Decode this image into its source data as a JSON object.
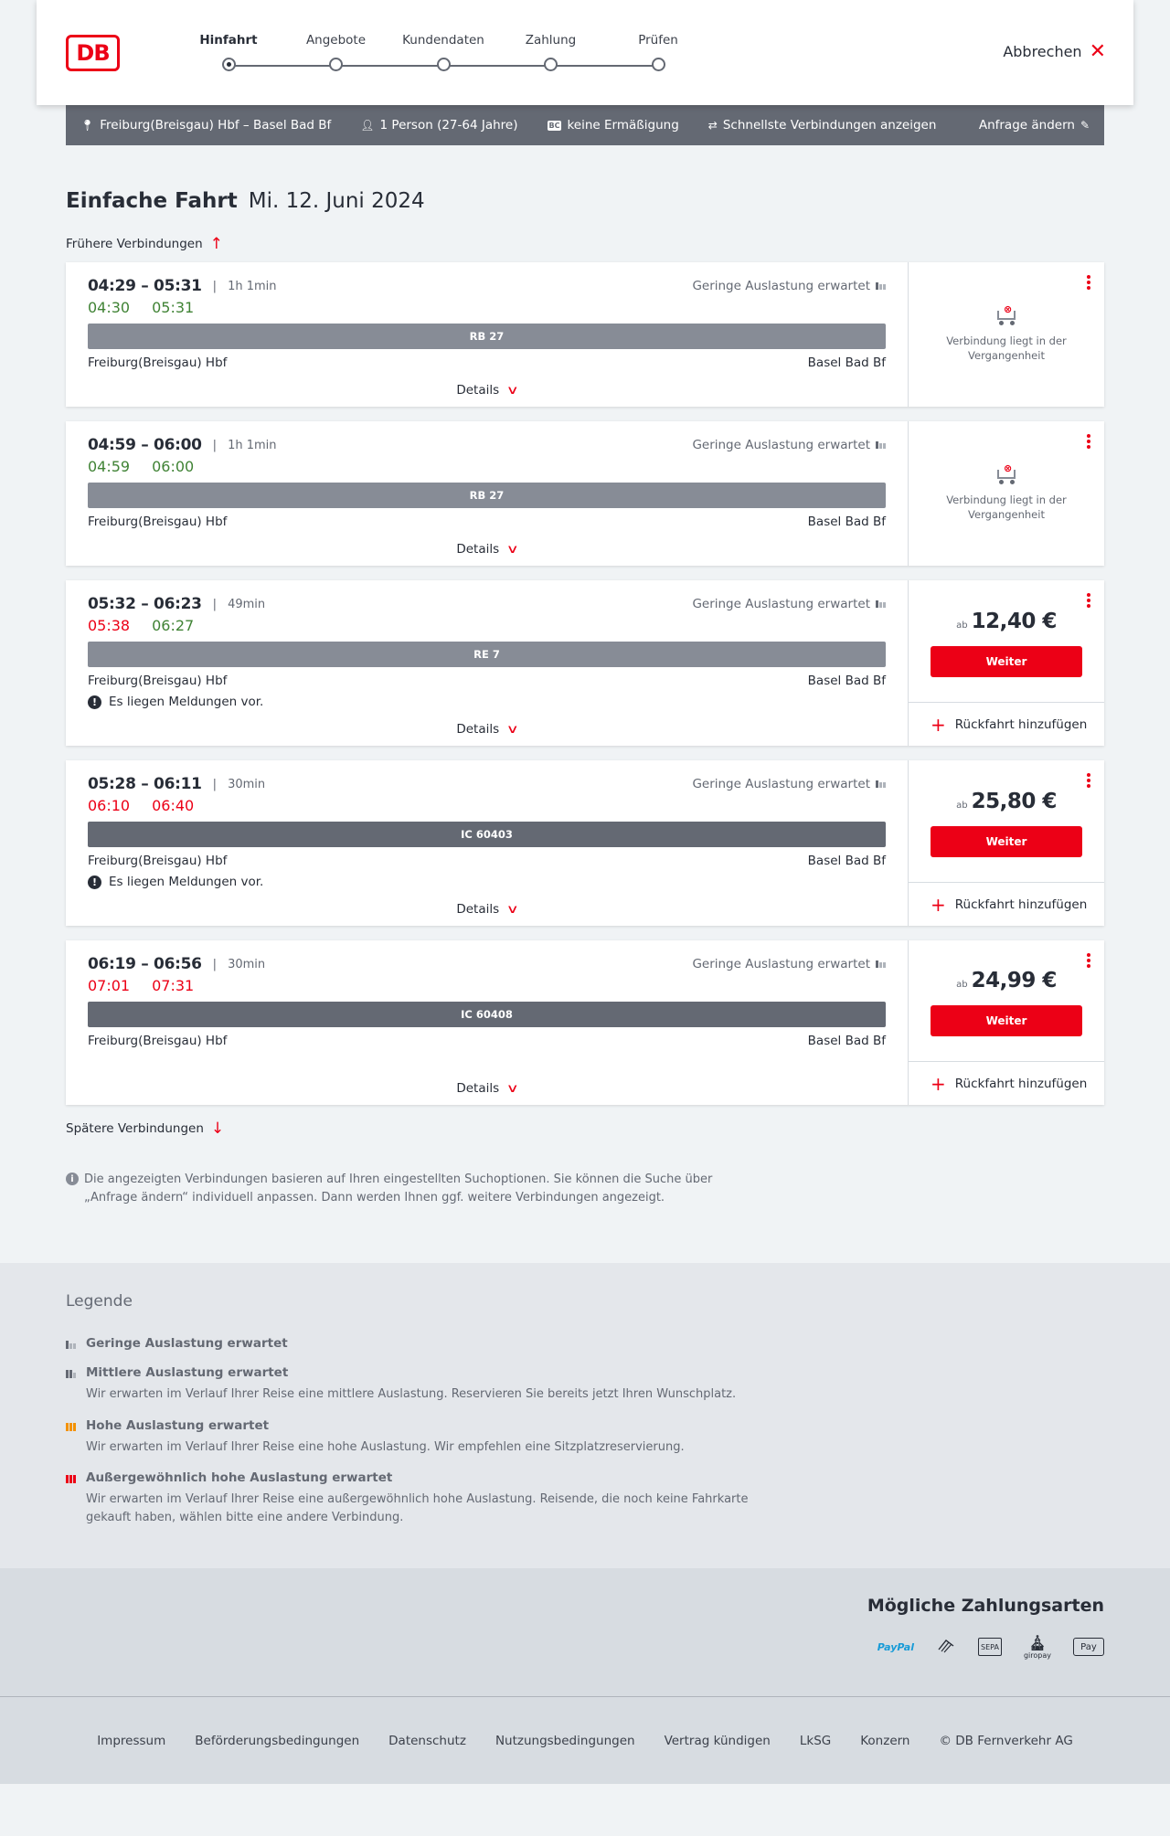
{
  "header": {
    "logo": "DB",
    "cancel_label": "Abbrechen",
    "steps": [
      "Hinfahrt",
      "Angebote",
      "Kundendaten",
      "Zahlung",
      "Prüfen"
    ]
  },
  "summary": {
    "route": "Freiburg(Breisgau) Hbf – Basel Bad Bf",
    "passengers": "1 Person (27-64 Jahre)",
    "bc_badge": "BC",
    "discount": "keine Ermäßigung",
    "option": "Schnellste Verbindungen anzeigen",
    "change_label": "Anfrage ändern"
  },
  "page": {
    "trip_type": "Einfache Fahrt",
    "date": "Mi. 12. Juni 2024",
    "earlier_label": "Frühere Verbindungen",
    "later_label": "Spätere Verbindungen",
    "note": "Die angezeigten Verbindungen basieren auf Ihren eingestellten Suchoptionen. Sie können die Suche über „Anfrage ändern“ individuell anpassen. Dann werden Ihnen ggf. weitere Verbindungen angezeigt."
  },
  "common": {
    "load_text": "Geringe Auslastung erwartet",
    "details_label": "Details",
    "past_text": "Verbindung liegt in der Vergangenheit",
    "price_prefix": "ab",
    "continue_label": "Weiter",
    "return_label": "Rückfahrt hinzufügen",
    "message_text": "Es liegen Meldungen vor.",
    "from": "Freiburg(Breisgau) Hbf",
    "to": "Basel Bad Bf"
  },
  "connections": [
    {
      "times": "04:29 – 05:31",
      "duration": "1h 1min",
      "rt_dep": "04:30",
      "rt_arr": "05:31",
      "dep_late": false,
      "arr_late": false,
      "train": "RB 27",
      "train_type": "regional",
      "has_message": false,
      "past": true,
      "price": ""
    },
    {
      "times": "04:59 – 06:00",
      "duration": "1h 1min",
      "rt_dep": "04:59",
      "rt_arr": "06:00",
      "dep_late": false,
      "arr_late": false,
      "train": "RB 27",
      "train_type": "regional",
      "has_message": false,
      "past": true,
      "price": ""
    },
    {
      "times": "05:32 – 06:23",
      "duration": "49min",
      "rt_dep": "05:38",
      "rt_arr": "06:27",
      "dep_late": true,
      "arr_late": false,
      "train": "RE 7",
      "train_type": "regional",
      "has_message": true,
      "past": false,
      "price": "12,40 €"
    },
    {
      "times": "05:28 – 06:11",
      "duration": "30min",
      "rt_dep": "06:10",
      "rt_arr": "06:40",
      "dep_late": true,
      "arr_late": true,
      "train": "IC 60403",
      "train_type": "ic",
      "has_message": true,
      "past": false,
      "price": "25,80 €"
    },
    {
      "times": "06:19 – 06:56",
      "duration": "30min",
      "rt_dep": "07:01",
      "rt_arr": "07:31",
      "dep_late": true,
      "arr_late": true,
      "train": "IC 60408",
      "train_type": "ic",
      "has_message": false,
      "past": false,
      "price": "24,99 €"
    }
  ],
  "legend": {
    "title": "Legende",
    "items": [
      {
        "title": "Geringe Auslastung erwartet",
        "desc": "",
        "level": "low"
      },
      {
        "title": "Mittlere Auslastung erwartet",
        "desc": "Wir erwarten im Verlauf Ihrer Reise eine mittlere Auslastung. Reservieren Sie bereits jetzt Ihren Wunschplatz.",
        "level": "medium"
      },
      {
        "title": "Hohe Auslastung erwartet",
        "desc": "Wir erwarten im Verlauf Ihrer Reise eine hohe Auslastung. Wir empfehlen eine Sitzplatzreservierung.",
        "level": "high"
      },
      {
        "title": "Außergewöhnlich hohe Auslastung erwartet",
        "desc": "Wir erwarten im Verlauf Ihrer Reise eine außergewöhnlich hohe Auslastung. Reisende, die noch keine Fahrkarte gekauft haben, wählen bitte eine andere Verbindung.",
        "level": "extreme"
      }
    ]
  },
  "payments": {
    "title": "Mögliche Zahlungsarten",
    "methods": [
      {
        "icon": "paypal-icon",
        "label": "PayPal"
      },
      {
        "icon": "credit-card-icon",
        "label": ""
      },
      {
        "icon": "sepa-icon",
        "label": "SEPA"
      },
      {
        "icon": "giropay-icon",
        "label": "giropay"
      },
      {
        "icon": "apple-pay-icon",
        "label": "Pay"
      }
    ]
  },
  "footer": {
    "links": [
      "Impressum",
      "Beförderungsbedingungen",
      "Datenschutz",
      "Nutzungsbedingungen",
      "Vertrag kündigen",
      "LkSG",
      "Konzern",
      "© DB Fernverkehr AG"
    ]
  },
  "colors": {
    "brand_red": "#ec0016",
    "on_time_green": "#408335",
    "summary_bg": "#646973",
    "high_load_orange": "#f39200"
  }
}
